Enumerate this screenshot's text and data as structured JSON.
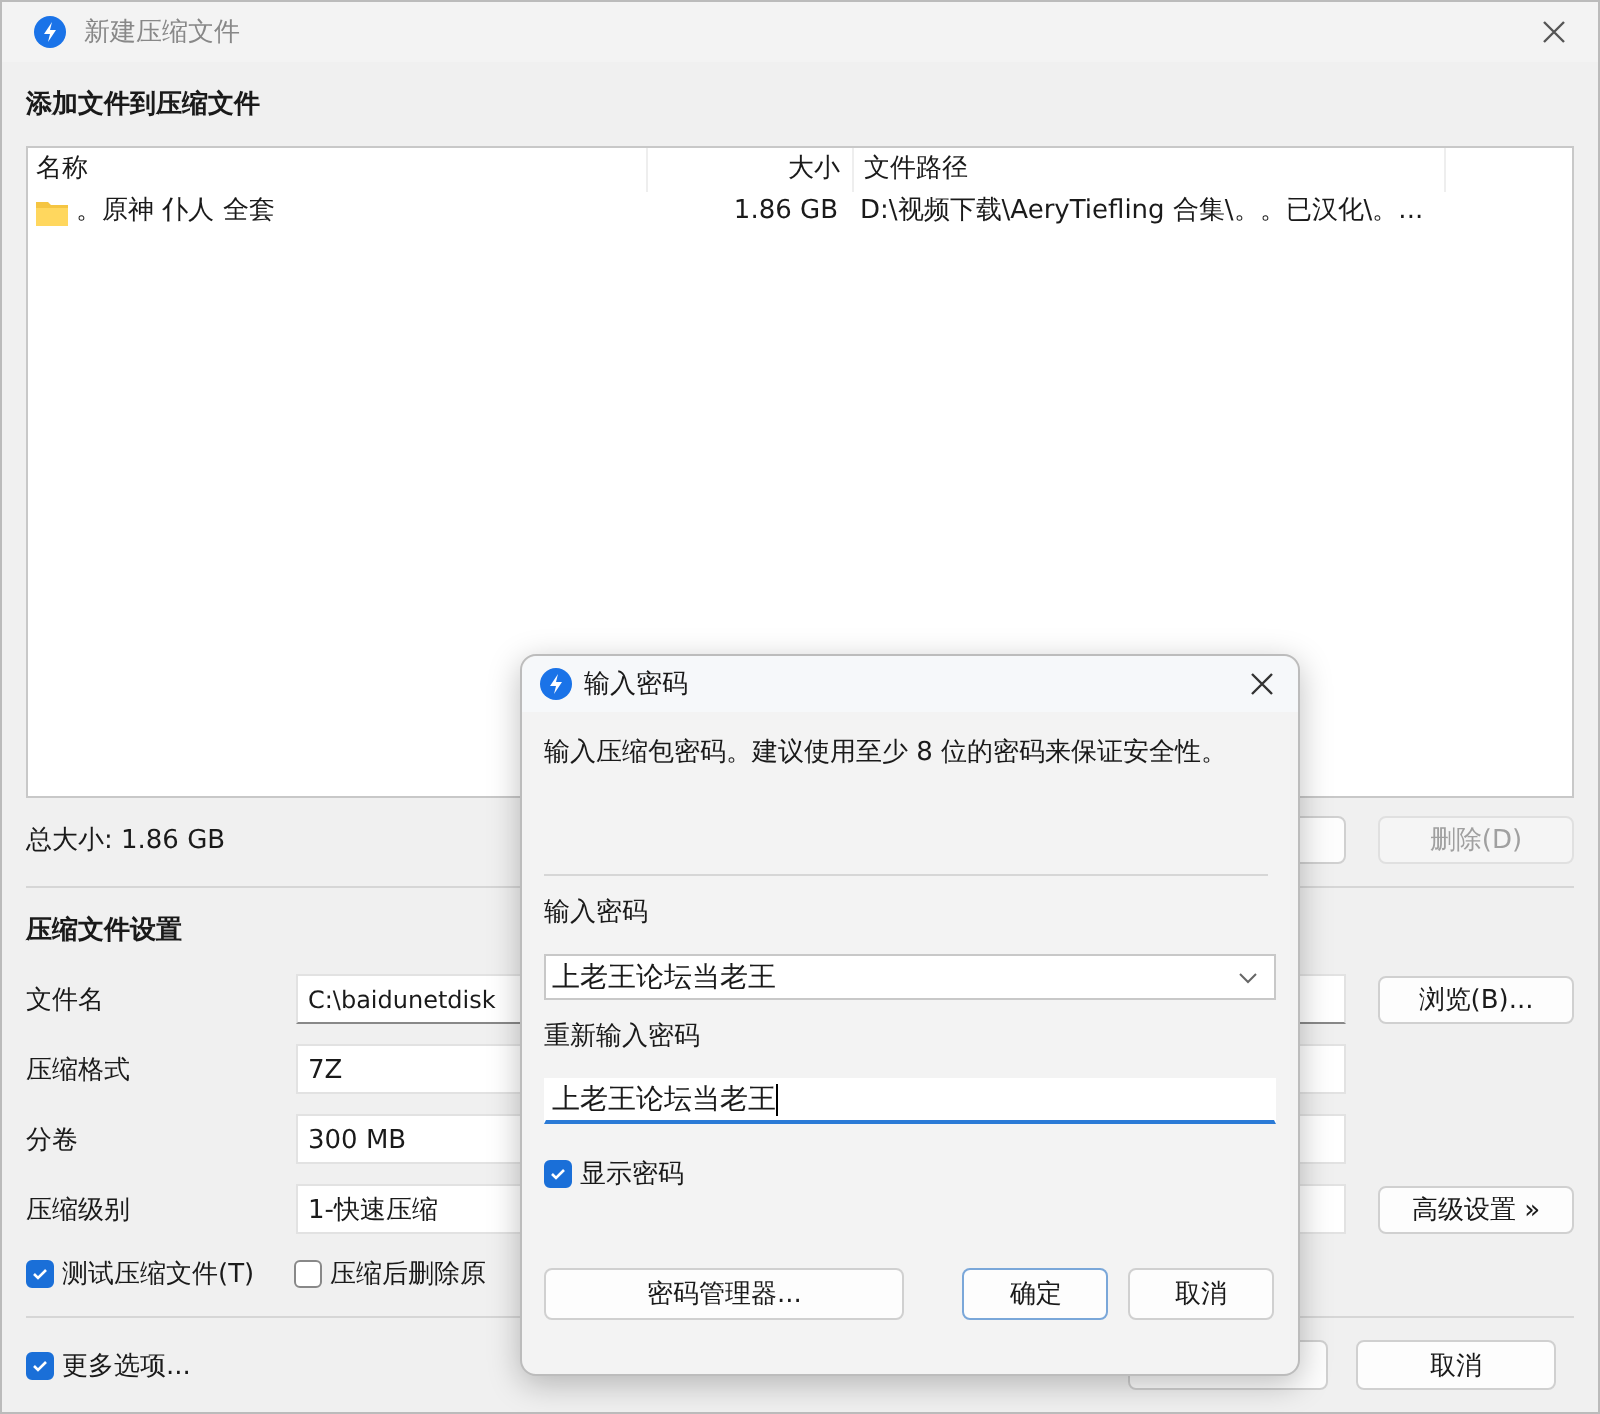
{
  "main_window": {
    "title": "新建压缩文件",
    "heading": "添加文件到压缩文件",
    "file_list": {
      "columns": [
        "名称",
        "大小",
        "文件路径"
      ],
      "rows": [
        {
          "kind": "folder",
          "name": "。原神 仆人 全套",
          "size": "1.86 GB",
          "path": "D:\\视频下载\\AeryTiefling 合集\\。。已汉化\\。..."
        }
      ]
    },
    "total_size": "总大小: 1.86 GB",
    "list_buttons": [
      {
        "disabled": false
      },
      {
        "label": "删除(D)",
        "disabled": true
      }
    ],
    "settings_heading": "压缩文件设置",
    "settings": [
      {
        "label": "文件名",
        "value": "C:\\baidunetdisk",
        "kind": "text",
        "button": "浏览(B)..."
      },
      {
        "label": "压缩格式",
        "value": "7Z",
        "kind": "select"
      },
      {
        "label": "分卷",
        "value": "300 MB",
        "kind": "select"
      },
      {
        "label": "压缩级别",
        "value": "1-快速压缩",
        "kind": "select",
        "button": "高级设置 »"
      }
    ],
    "options": [
      {
        "label": "测试压缩文件(T)",
        "checked": true
      },
      {
        "label": "压缩后删除原",
        "checked": false
      }
    ],
    "more_options": {
      "label": "更多选项...",
      "checked": true
    },
    "footer_buttons": [
      "取消"
    ]
  },
  "password_dialog": {
    "title": "输入密码",
    "description": "输入压缩包密码。建议使用至少 8 位的密码来保证安全性。",
    "fields": [
      {
        "label": "输入密码",
        "value": "上老王论坛当老王",
        "kind": "combo",
        "focused": false
      },
      {
        "label": "重新输入密码",
        "value": "上老王论坛当老王",
        "kind": "text",
        "focused": true
      }
    ],
    "show_password": {
      "label": "显示密码",
      "checked": true
    },
    "buttons": [
      {
        "label": "密码管理器...",
        "default": false
      },
      {
        "label": "确定",
        "default": true
      },
      {
        "label": "取消",
        "default": false
      }
    ]
  }
}
